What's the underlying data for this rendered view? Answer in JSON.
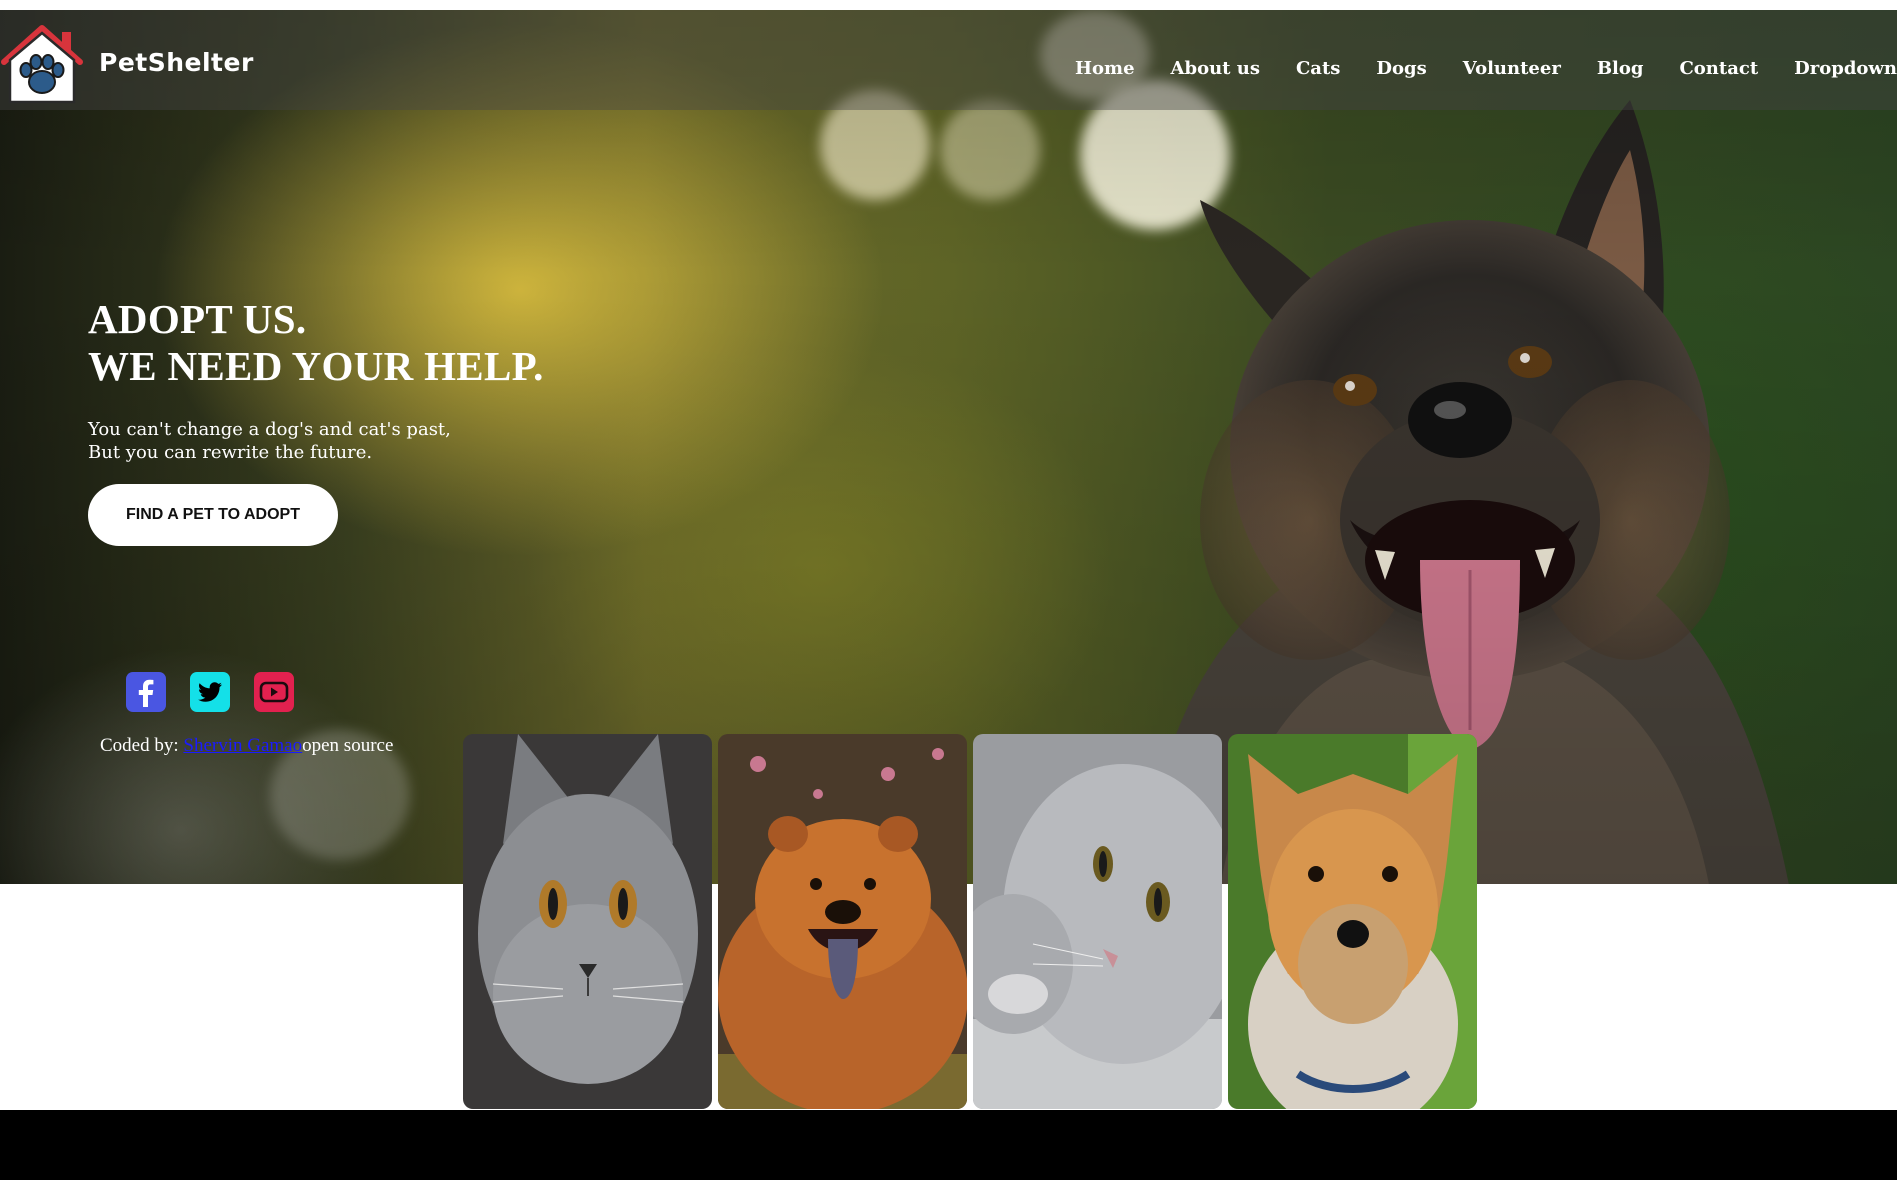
{
  "brand": {
    "name": "PetShelter",
    "logo_icon": "house-paw-icon"
  },
  "nav": {
    "items": [
      "Home",
      "About us",
      "Cats",
      "Dogs",
      "Volunteer",
      "Blog",
      "Contact",
      "Dropdown"
    ]
  },
  "hero": {
    "headline_line1": "ADOPT US.",
    "headline_line2": "WE NEED YOUR HELP.",
    "sub_line1": "You can't change a dog's and cat's past,",
    "sub_line2": "But you can rewrite the future.",
    "cta_label": "FIND A PET TO ADOPT",
    "image_icon": "german-shepherd-photo"
  },
  "social": {
    "items": [
      {
        "icon": "facebook-icon",
        "color": "#4a56e2"
      },
      {
        "icon": "twitter-icon",
        "color": "#14e0e8"
      },
      {
        "icon": "youtube-icon",
        "color": "#e2214f"
      }
    ]
  },
  "credit": {
    "prefix": "Coded by: ",
    "author": "Shervin Gamao",
    "suffix": "open source"
  },
  "cards": [
    {
      "icon": "grey-cat-photo"
    },
    {
      "icon": "chow-chow-dog-photo"
    },
    {
      "icon": "silver-cat-photo"
    },
    {
      "icon": "yorkshire-terrier-photo"
    }
  ],
  "colors": {
    "nav_overlay": "#464646",
    "hero_accent": "#e2c440",
    "footer": "#000000",
    "link": "#1a1aff"
  }
}
